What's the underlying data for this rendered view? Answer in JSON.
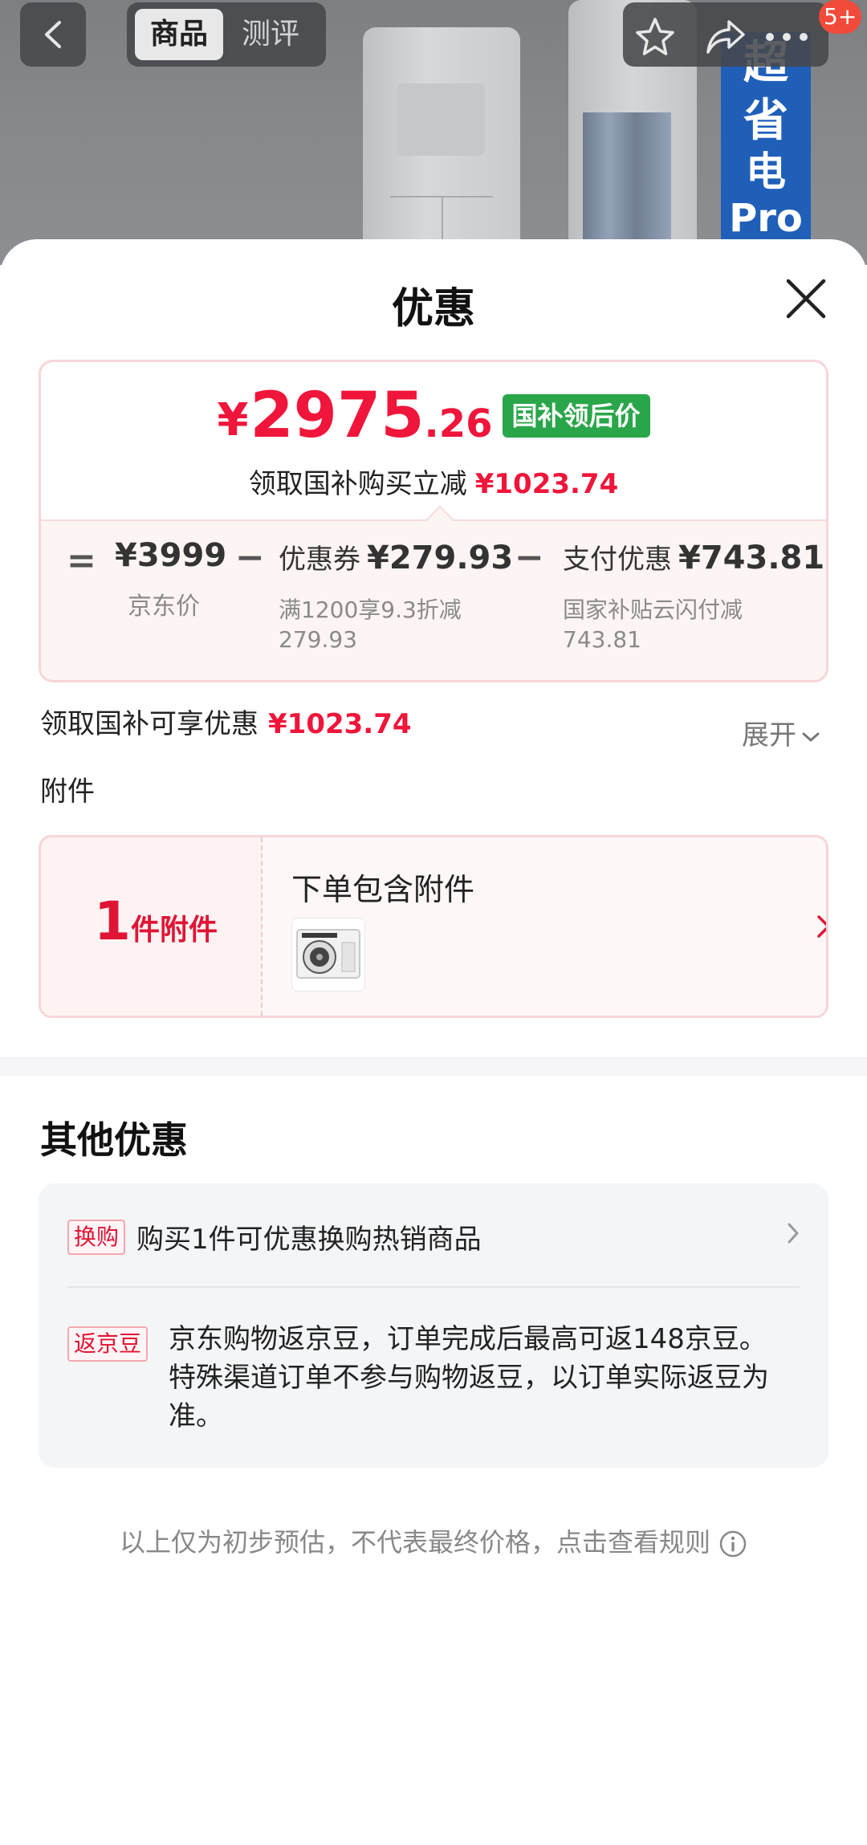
{
  "header": {
    "tabs": [
      {
        "label": "商品",
        "active": true
      },
      {
        "label": "测评",
        "active": false
      }
    ],
    "badge": "5+",
    "banner_lines": [
      "超",
      "省",
      "电",
      "Pro"
    ]
  },
  "sheet": {
    "title": "优惠",
    "price_card": {
      "currency": "¥",
      "price_int": "2975",
      "price_dec": ".26",
      "price_tag": "国补领后价",
      "sub_text": "领取国补购买立减",
      "sub_amount": "¥1023.74",
      "breakdown": {
        "op_equals": "=",
        "op_minus": "−",
        "jd_price": "¥3999",
        "jd_price_label": "京东价",
        "coupon_label": "优惠券",
        "coupon_amount": "¥279.93",
        "coupon_desc_1": "满1200享9.3折减",
        "coupon_desc_2": "279.93",
        "pay_label": "支付优惠",
        "pay_amount": "¥743.81",
        "pay_desc_1": "国家补贴云闪付减",
        "pay_desc_2": "743.81"
      }
    },
    "savings_text": "领取国补可享优惠",
    "savings_amount": "¥1023.74",
    "expand_label": "展开",
    "attachments_title": "附件",
    "attachment_card": {
      "count": "1",
      "count_unit": "件附件",
      "label": "下单包含附件"
    },
    "other_title": "其他优惠",
    "other": [
      {
        "tag": "换购",
        "text": "购买1件可优惠换购热销商品"
      },
      {
        "tag": "返京豆",
        "text": "京东购物返京豆，订单完成后最高可返148京豆。特殊渠道订单不参与购物返豆，以订单实际返豆为准。"
      }
    ],
    "footnote": "以上仅为初步预估，不代表最终价格，点击查看规则"
  },
  "colors": {
    "accent_red": "#f0153a",
    "tag_green": "#2aa64a",
    "badge_red": "#f24a3a"
  }
}
